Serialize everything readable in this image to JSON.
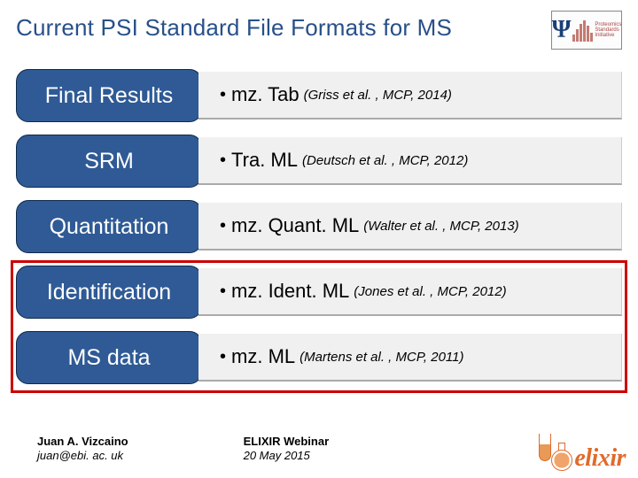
{
  "title": "Current PSI Standard File Formats for MS",
  "logo_psi": {
    "label": "Proteomics\nStandards\nInitiative"
  },
  "rows": [
    {
      "label": "Final Results",
      "format": "mz. Tab",
      "cite": "(Griss et al. , MCP, 2014)"
    },
    {
      "label": "SRM",
      "format": "Tra. ML",
      "cite": "(Deutsch et al. , MCP, 2012)"
    },
    {
      "label": "Quantitation",
      "format": "mz. Quant. ML",
      "cite": "(Walter et al. , MCP, 2013)"
    },
    {
      "label": "Identification",
      "format": "mz. Ident. ML",
      "cite": "(Jones et al. , MCP, 2012)"
    },
    {
      "label": "MS data",
      "format": "mz. ML",
      "cite": "(Martens et al. , MCP, 2011)"
    }
  ],
  "footer": {
    "author_name": "Juan A. Vizcaino",
    "author_email": "juan@ebi. ac. uk",
    "event_name": "ELIXIR Webinar",
    "event_date": "20 May 2015"
  },
  "elixir_word": "elixir"
}
